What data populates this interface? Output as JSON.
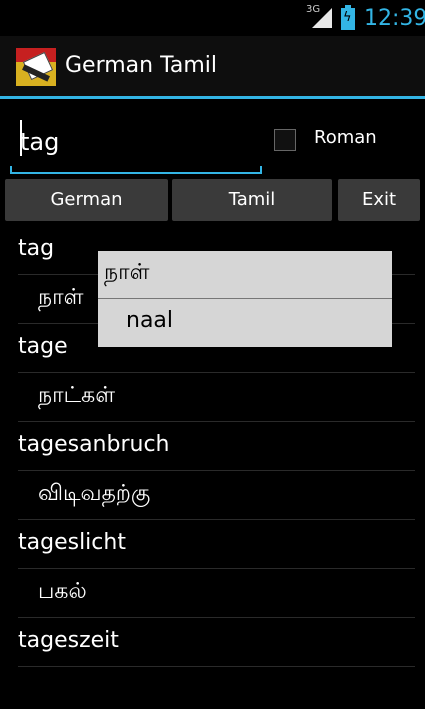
{
  "status_bar": {
    "network": "3G",
    "time": "12:39"
  },
  "app": {
    "title": "German Tamil"
  },
  "search": {
    "value": "tag"
  },
  "roman": {
    "label": "Roman",
    "checked": false
  },
  "buttons": {
    "german": "German",
    "tamil": "Tamil",
    "exit": "Exit"
  },
  "list": [
    {
      "text": "tag",
      "kind": "german"
    },
    {
      "text": "நாள்",
      "kind": "tamil"
    },
    {
      "text": "tage",
      "kind": "german"
    },
    {
      "text": "நாட்கள்",
      "kind": "tamil"
    },
    {
      "text": "tagesanbruch",
      "kind": "german"
    },
    {
      "text": "விடிவதற்கு",
      "kind": "tamil"
    },
    {
      "text": "tageslicht",
      "kind": "german"
    },
    {
      "text": "பகல்",
      "kind": "tamil"
    },
    {
      "text": "tageszeit",
      "kind": "german"
    }
  ],
  "popup": {
    "tamil": "நாள்",
    "roman": "naal"
  },
  "colors": {
    "accent": "#33b5e5",
    "background": "#000000",
    "button": "#3a3a3a",
    "popup": "#d6d6d6"
  },
  "icons": [
    "signal-icon",
    "battery-icon",
    "app-icon"
  ]
}
